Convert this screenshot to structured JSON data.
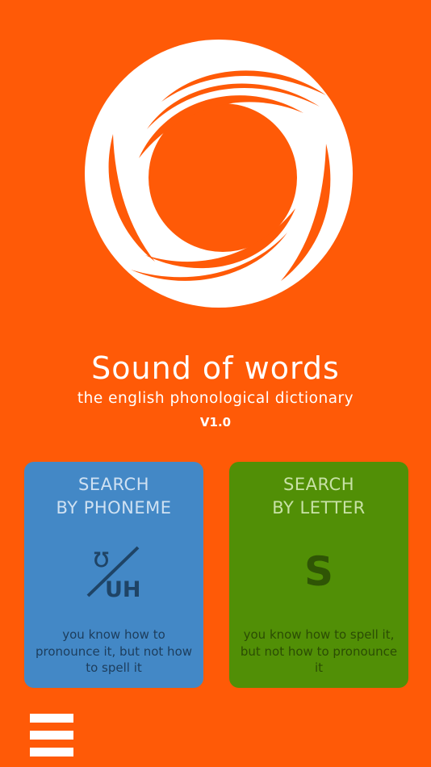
{
  "app": {
    "title": "Sound of words",
    "subtitle": "the english phonological dictionary",
    "version": "V1.0",
    "logo_icon": "swirl-logo-icon"
  },
  "cards": {
    "phoneme": {
      "heading_line1": "SEARCH",
      "heading_line2": "BY PHONEME",
      "symbol_top": "ʊ",
      "symbol_bottom": "UH",
      "description": "you know how to pronounce it, but not how to spell it",
      "color": "#4388c6"
    },
    "letter": {
      "heading_line1": "SEARCH",
      "heading_line2": "BY LETTER",
      "symbol": "S",
      "description": "you know how to spell it, but not how to pronounce it",
      "color": "#518f06"
    }
  },
  "menu": {
    "icon": "hamburger-menu-icon"
  },
  "colors": {
    "background": "#ff5a07",
    "foreground": "#ffffff"
  }
}
